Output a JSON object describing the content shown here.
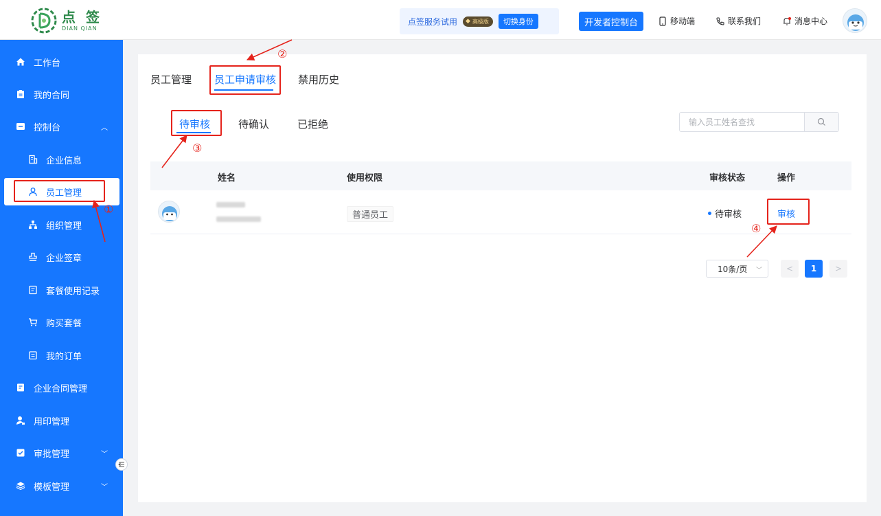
{
  "header": {
    "logo_cn": "点 签",
    "logo_en": "DIAN QIAN",
    "trial_text": "点签服务试用",
    "badge_label": "高级版",
    "switch_label": "切换身份",
    "dev_console": "开发者控制台",
    "mobile": "移动端",
    "contact": "联系我们",
    "messages": "消息中心"
  },
  "sidebar": {
    "items": [
      {
        "label": "工作台",
        "icon": "home-icon"
      },
      {
        "label": "我的合同",
        "icon": "clipboard-icon"
      },
      {
        "label": "控制台",
        "icon": "console-icon"
      },
      {
        "label": "企业信息",
        "icon": "building-icon"
      },
      {
        "label": "员工管理",
        "icon": "user-icon"
      },
      {
        "label": "组织管理",
        "icon": "org-icon"
      },
      {
        "label": "企业签章",
        "icon": "stamp-icon"
      },
      {
        "label": "套餐使用记录",
        "icon": "record-icon"
      },
      {
        "label": "购买套餐",
        "icon": "cart-icon"
      },
      {
        "label": "我的订单",
        "icon": "order-icon"
      },
      {
        "label": "企业合同管理",
        "icon": "contract-icon"
      },
      {
        "label": "用印管理",
        "icon": "seal-user-icon"
      },
      {
        "label": "审批管理",
        "icon": "approval-icon"
      },
      {
        "label": "模板管理",
        "icon": "layers-icon"
      }
    ]
  },
  "main": {
    "tabs": [
      {
        "label": "员工管理"
      },
      {
        "label": "员工申请审核"
      },
      {
        "label": "禁用历史"
      }
    ],
    "subtabs": [
      {
        "label": "待审核"
      },
      {
        "label": "待确认"
      },
      {
        "label": "已拒绝"
      }
    ],
    "search": {
      "placeholder": "输入员工姓名查找"
    },
    "table": {
      "columns": {
        "name": "姓名",
        "permission": "使用权限",
        "status": "审核状态",
        "action": "操作"
      },
      "rows": [
        {
          "permission": "普通员工",
          "status": "待审核",
          "action": "审核"
        }
      ]
    },
    "pagination": {
      "page_size": "10条/页",
      "current_page": "1"
    }
  },
  "annotations": [
    "①",
    "②",
    "③",
    "④"
  ],
  "colors": {
    "primary": "#1677ff",
    "annotation": "#e5231b",
    "logo": "#2f8a4c"
  }
}
